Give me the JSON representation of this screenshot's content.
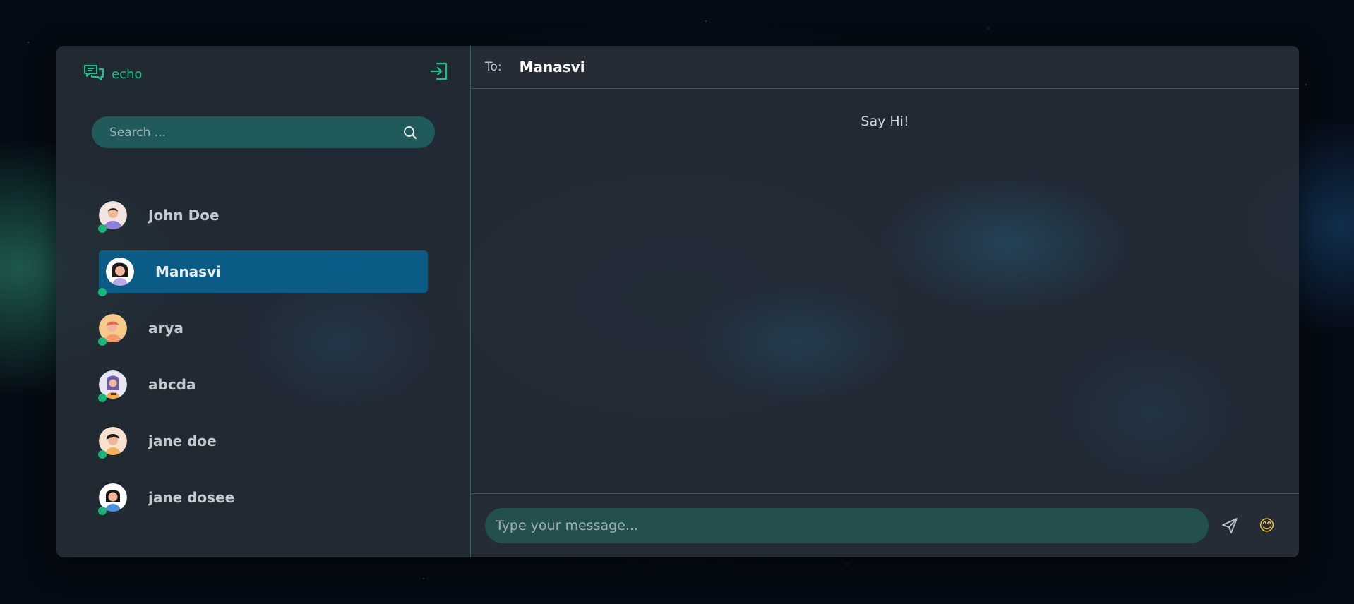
{
  "app": {
    "brand": "echo"
  },
  "search": {
    "placeholder": "Search ..."
  },
  "contacts": [
    {
      "name": "John Doe",
      "online": true,
      "active": false
    },
    {
      "name": "Manasvi",
      "online": true,
      "active": true
    },
    {
      "name": "arya",
      "online": true,
      "active": false
    },
    {
      "name": "abcda",
      "online": true,
      "active": false
    },
    {
      "name": "jane doe",
      "online": true,
      "active": false
    },
    {
      "name": "jane dosee",
      "online": true,
      "active": false
    }
  ],
  "chat": {
    "to_label": "To:",
    "to_name": "Manasvi",
    "empty_text": "Say Hi!",
    "composer_placeholder": "Type your message...",
    "emoji": "😊"
  },
  "icons": {
    "logo": "chat-bubbles-icon",
    "logout": "logout-icon",
    "search": "search-icon",
    "send": "send-icon",
    "emoji": "emoji-icon"
  },
  "colors": {
    "accent": "#19c08a",
    "active_contact": "#0b5b87",
    "online": "#19b477",
    "search_bg": "#215a5a"
  }
}
